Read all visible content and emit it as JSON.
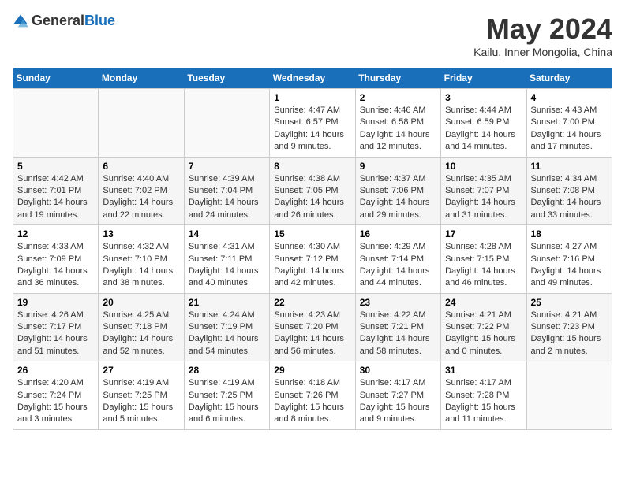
{
  "logo": {
    "general": "General",
    "blue": "Blue"
  },
  "title": "May 2024",
  "location": "Kailu, Inner Mongolia, China",
  "weekdays": [
    "Sunday",
    "Monday",
    "Tuesday",
    "Wednesday",
    "Thursday",
    "Friday",
    "Saturday"
  ],
  "weeks": [
    [
      {
        "day": "",
        "info": ""
      },
      {
        "day": "",
        "info": ""
      },
      {
        "day": "",
        "info": ""
      },
      {
        "day": "1",
        "info": "Sunrise: 4:47 AM\nSunset: 6:57 PM\nDaylight: 14 hours and 9 minutes."
      },
      {
        "day": "2",
        "info": "Sunrise: 4:46 AM\nSunset: 6:58 PM\nDaylight: 14 hours and 12 minutes."
      },
      {
        "day": "3",
        "info": "Sunrise: 4:44 AM\nSunset: 6:59 PM\nDaylight: 14 hours and 14 minutes."
      },
      {
        "day": "4",
        "info": "Sunrise: 4:43 AM\nSunset: 7:00 PM\nDaylight: 14 hours and 17 minutes."
      }
    ],
    [
      {
        "day": "5",
        "info": "Sunrise: 4:42 AM\nSunset: 7:01 PM\nDaylight: 14 hours and 19 minutes."
      },
      {
        "day": "6",
        "info": "Sunrise: 4:40 AM\nSunset: 7:02 PM\nDaylight: 14 hours and 22 minutes."
      },
      {
        "day": "7",
        "info": "Sunrise: 4:39 AM\nSunset: 7:04 PM\nDaylight: 14 hours and 24 minutes."
      },
      {
        "day": "8",
        "info": "Sunrise: 4:38 AM\nSunset: 7:05 PM\nDaylight: 14 hours and 26 minutes."
      },
      {
        "day": "9",
        "info": "Sunrise: 4:37 AM\nSunset: 7:06 PM\nDaylight: 14 hours and 29 minutes."
      },
      {
        "day": "10",
        "info": "Sunrise: 4:35 AM\nSunset: 7:07 PM\nDaylight: 14 hours and 31 minutes."
      },
      {
        "day": "11",
        "info": "Sunrise: 4:34 AM\nSunset: 7:08 PM\nDaylight: 14 hours and 33 minutes."
      }
    ],
    [
      {
        "day": "12",
        "info": "Sunrise: 4:33 AM\nSunset: 7:09 PM\nDaylight: 14 hours and 36 minutes."
      },
      {
        "day": "13",
        "info": "Sunrise: 4:32 AM\nSunset: 7:10 PM\nDaylight: 14 hours and 38 minutes."
      },
      {
        "day": "14",
        "info": "Sunrise: 4:31 AM\nSunset: 7:11 PM\nDaylight: 14 hours and 40 minutes."
      },
      {
        "day": "15",
        "info": "Sunrise: 4:30 AM\nSunset: 7:12 PM\nDaylight: 14 hours and 42 minutes."
      },
      {
        "day": "16",
        "info": "Sunrise: 4:29 AM\nSunset: 7:14 PM\nDaylight: 14 hours and 44 minutes."
      },
      {
        "day": "17",
        "info": "Sunrise: 4:28 AM\nSunset: 7:15 PM\nDaylight: 14 hours and 46 minutes."
      },
      {
        "day": "18",
        "info": "Sunrise: 4:27 AM\nSunset: 7:16 PM\nDaylight: 14 hours and 49 minutes."
      }
    ],
    [
      {
        "day": "19",
        "info": "Sunrise: 4:26 AM\nSunset: 7:17 PM\nDaylight: 14 hours and 51 minutes."
      },
      {
        "day": "20",
        "info": "Sunrise: 4:25 AM\nSunset: 7:18 PM\nDaylight: 14 hours and 52 minutes."
      },
      {
        "day": "21",
        "info": "Sunrise: 4:24 AM\nSunset: 7:19 PM\nDaylight: 14 hours and 54 minutes."
      },
      {
        "day": "22",
        "info": "Sunrise: 4:23 AM\nSunset: 7:20 PM\nDaylight: 14 hours and 56 minutes."
      },
      {
        "day": "23",
        "info": "Sunrise: 4:22 AM\nSunset: 7:21 PM\nDaylight: 14 hours and 58 minutes."
      },
      {
        "day": "24",
        "info": "Sunrise: 4:21 AM\nSunset: 7:22 PM\nDaylight: 15 hours and 0 minutes."
      },
      {
        "day": "25",
        "info": "Sunrise: 4:21 AM\nSunset: 7:23 PM\nDaylight: 15 hours and 2 minutes."
      }
    ],
    [
      {
        "day": "26",
        "info": "Sunrise: 4:20 AM\nSunset: 7:24 PM\nDaylight: 15 hours and 3 minutes."
      },
      {
        "day": "27",
        "info": "Sunrise: 4:19 AM\nSunset: 7:25 PM\nDaylight: 15 hours and 5 minutes."
      },
      {
        "day": "28",
        "info": "Sunrise: 4:19 AM\nSunset: 7:25 PM\nDaylight: 15 hours and 6 minutes."
      },
      {
        "day": "29",
        "info": "Sunrise: 4:18 AM\nSunset: 7:26 PM\nDaylight: 15 hours and 8 minutes."
      },
      {
        "day": "30",
        "info": "Sunrise: 4:17 AM\nSunset: 7:27 PM\nDaylight: 15 hours and 9 minutes."
      },
      {
        "day": "31",
        "info": "Sunrise: 4:17 AM\nSunset: 7:28 PM\nDaylight: 15 hours and 11 minutes."
      },
      {
        "day": "",
        "info": ""
      }
    ]
  ]
}
